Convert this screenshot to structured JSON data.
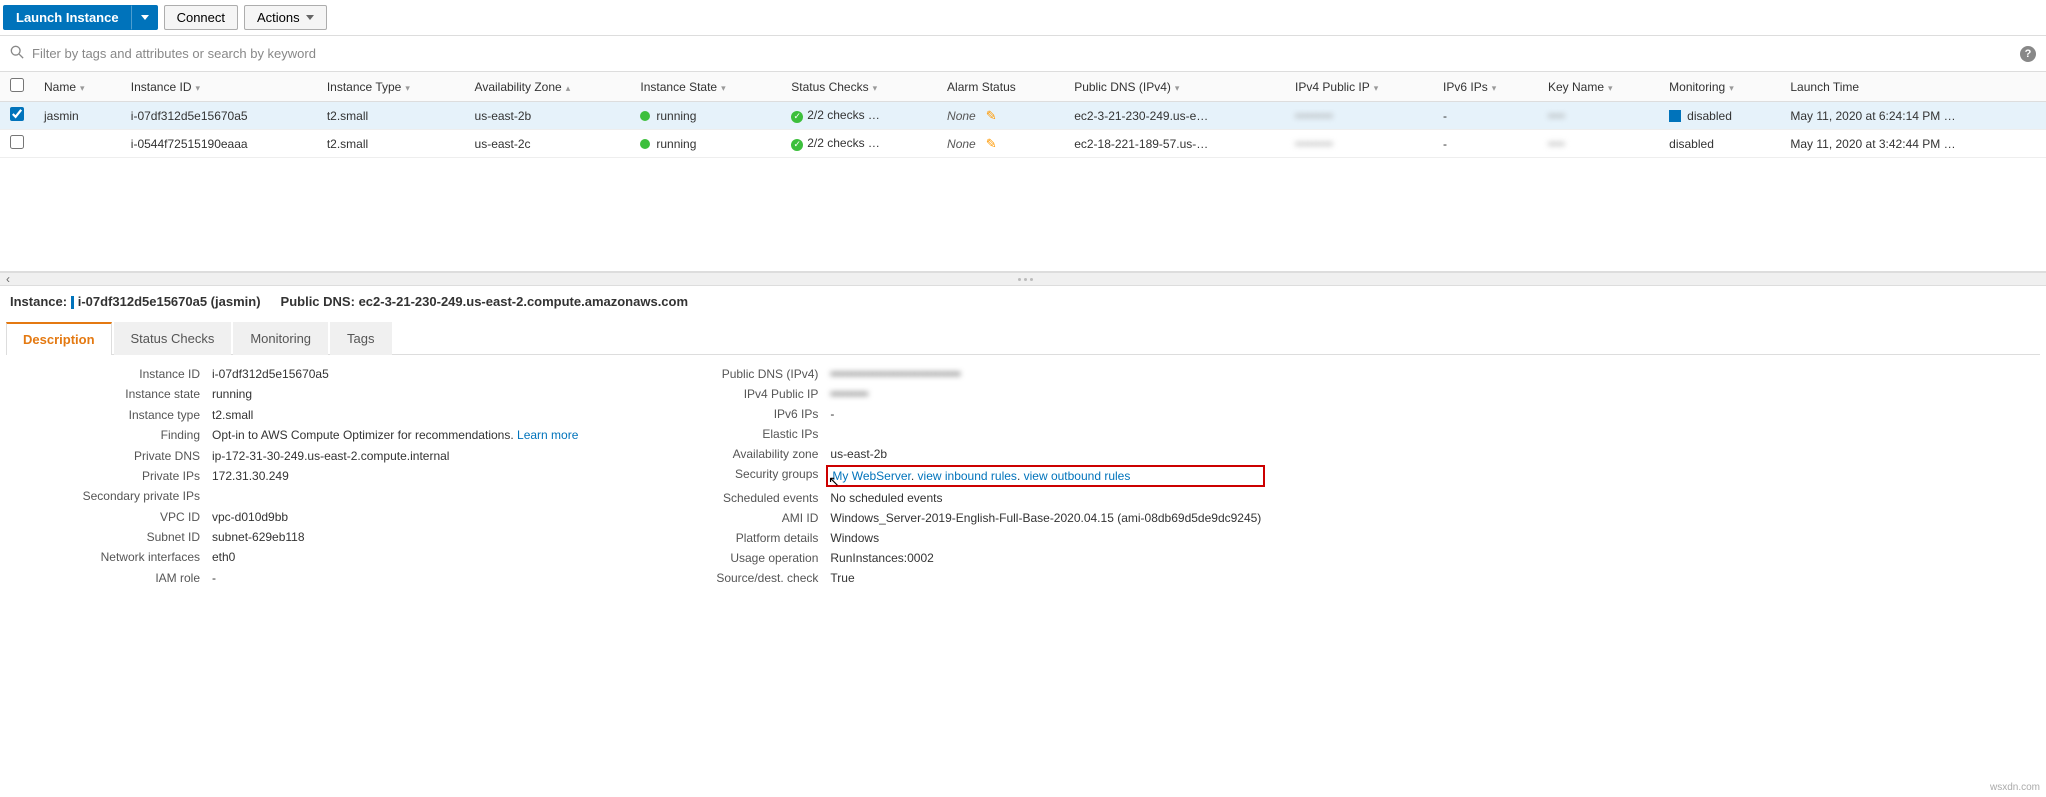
{
  "toolbar": {
    "launch": "Launch Instance",
    "connect": "Connect",
    "actions": "Actions"
  },
  "filter": {
    "placeholder": "Filter by tags and attributes or search by keyword"
  },
  "columns": {
    "name": "Name",
    "instance_id": "Instance ID",
    "instance_type": "Instance Type",
    "az": "Availability Zone",
    "instance_state": "Instance State",
    "status_checks": "Status Checks",
    "alarm_status": "Alarm Status",
    "public_dns": "Public DNS (IPv4)",
    "ipv4_public": "IPv4 Public IP",
    "ipv6": "IPv6 IPs",
    "key_name": "Key Name",
    "monitoring": "Monitoring",
    "launch_time": "Launch Time"
  },
  "rows": [
    {
      "selected": true,
      "name": "jasmin",
      "instance_id": "i-07df312d5e15670a5",
      "instance_type": "t2.small",
      "az": "us-east-2b",
      "state": "running",
      "status_checks": "2/2 checks …",
      "alarm_status": "None",
      "public_dns": "ec2-3-21-230-249.us-e…",
      "ipv4_public": "•••••••••",
      "ipv6": "-",
      "key_name": "••••",
      "monitoring": "disabled",
      "monitoring_box": true,
      "launch_time": "May 11, 2020 at 6:24:14 PM …"
    },
    {
      "selected": false,
      "name": "",
      "instance_id": "i-0544f72515190eaaa",
      "instance_type": "t2.small",
      "az": "us-east-2c",
      "state": "running",
      "status_checks": "2/2 checks …",
      "alarm_status": "None",
      "public_dns": "ec2-18-221-189-57.us-…",
      "ipv4_public": "•••••••••",
      "ipv6": "-",
      "key_name": "••••",
      "monitoring": "disabled",
      "monitoring_box": false,
      "launch_time": "May 11, 2020 at 3:42:44 PM …"
    }
  ],
  "detail_header": {
    "instance_label": "Instance:",
    "instance_id": "i-07df312d5e15670a5 (jasmin)",
    "dns_label": "Public DNS:",
    "dns_value": "ec2-3-21-230-249.us-east-2.compute.amazonaws.com"
  },
  "tabs": {
    "description": "Description",
    "status_checks": "Status Checks",
    "monitoring": "Monitoring",
    "tags": "Tags"
  },
  "description": {
    "left": {
      "instance_id_l": "Instance ID",
      "instance_id_v": "i-07df312d5e15670a5",
      "instance_state_l": "Instance state",
      "instance_state_v": "running",
      "instance_type_l": "Instance type",
      "instance_type_v": "t2.small",
      "finding_l": "Finding",
      "finding_v": "Opt-in to AWS Compute Optimizer for recommendations.",
      "finding_link": "Learn more",
      "private_dns_l": "Private DNS",
      "private_dns_v": "ip-172-31-30-249.us-east-2.compute.internal",
      "private_ips_l": "Private IPs",
      "private_ips_v": "172.31.30.249",
      "secondary_l": "Secondary private IPs",
      "secondary_v": "",
      "vpc_l": "VPC ID",
      "vpc_v": "vpc-d010d9bb",
      "subnet_l": "Subnet ID",
      "subnet_v": "subnet-629eb118",
      "net_l": "Network interfaces",
      "net_v": "eth0",
      "iam_l": "IAM role",
      "iam_v": "-"
    },
    "right": {
      "pdns_l": "Public DNS (IPv4)",
      "pdns_v": "•••••••••••••••••••••••••••••••",
      "pip_l": "IPv4 Public IP",
      "pip_v": "•••••••••",
      "ipv6_l": "IPv6 IPs",
      "ipv6_v": "-",
      "eip_l": "Elastic IPs",
      "eip_v": "",
      "az_l": "Availability zone",
      "az_v": "us-east-2b",
      "sg_l": "Security groups",
      "sg_v1": "My WebServer",
      "sg_v2": "view inbound rules",
      "sg_v3": "view outbound rules",
      "sched_l": "Scheduled events",
      "sched_v": "No scheduled events",
      "ami_l": "AMI ID",
      "ami_v": "Windows_Server-2019-English-Full-Base-2020.04.15 (ami-08db69d5de9dc9245)",
      "plat_l": "Platform details",
      "plat_v": "Windows",
      "usage_l": "Usage operation",
      "usage_v": "RunInstances:0002",
      "srcdst_l": "Source/dest. check",
      "srcdst_v": "True"
    }
  },
  "watermark": "wsxdn.com"
}
